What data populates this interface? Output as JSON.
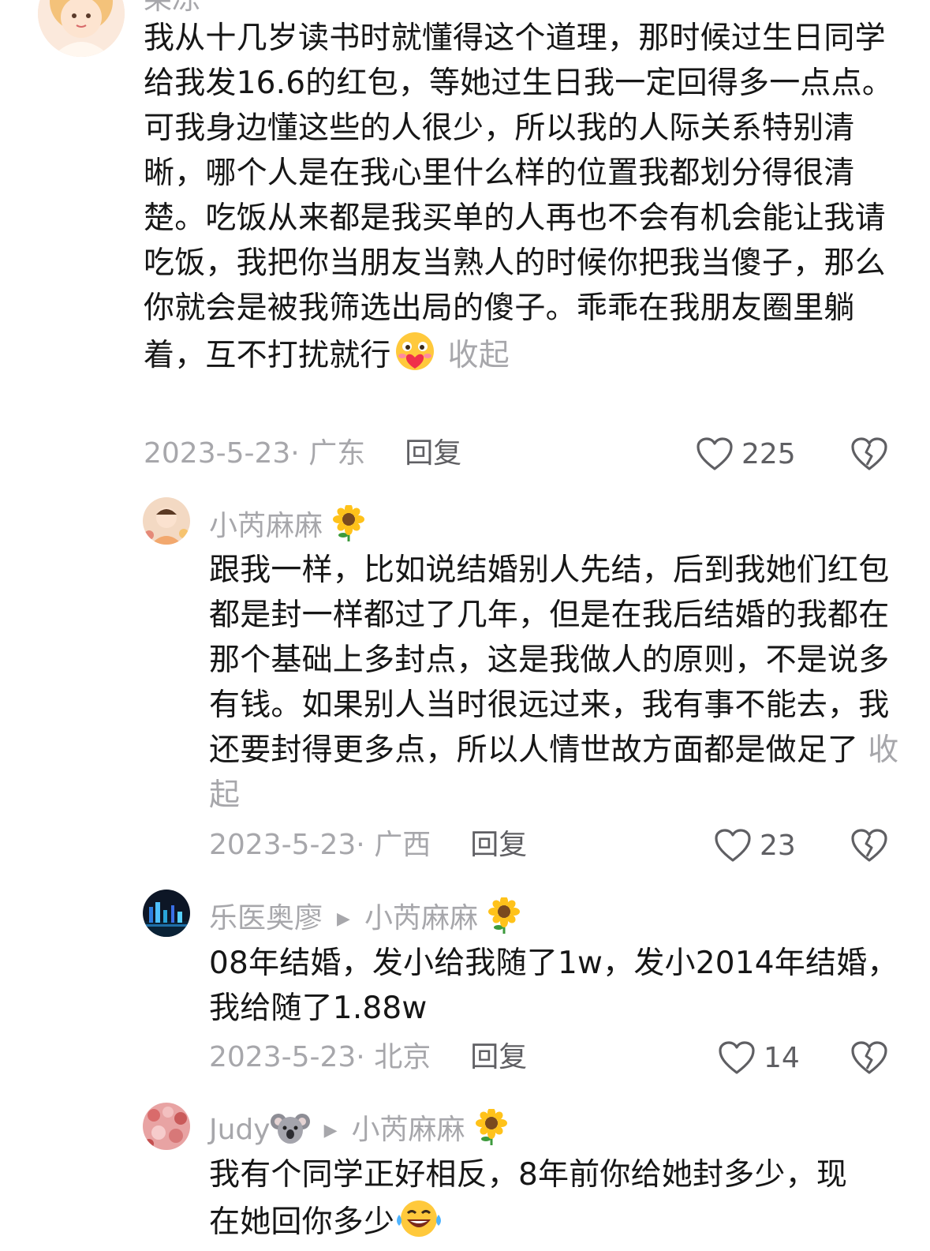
{
  "comments": [
    {
      "username": "果冻",
      "text": "我从十几岁读书时就懂得这个道理，那时候过生日同学给我发16.6的红包，等她过生日我一定回得多一点点。可我身边懂这些的人很少，所以我的人际关系特别清晰，哪个人是在我心里什么样的位置我都划分得很清楚。吃饭从来都是我买单的人再也不会有机会能让我请吃饭，我把你当朋友当熟人的时候你把我当傻子，那么你就会是被我筛选出局的傻子。乖乖在我朋友圈里躺着，互不打扰就行",
      "emoji": "love-face-emoji",
      "fold_label": "收起",
      "date_location": "2023-5-23· 广东",
      "reply_label": "回复",
      "likes": "225"
    },
    {
      "username": "小芮麻麻",
      "username_emoji": "sunflower-emoji",
      "text": "跟我一样，比如说结婚别人先结，后到我她们红包都是封一样都过了几年，但是在我后结婚的我都在那个基础上多封点，这是我做人的原则，不是说多有钱。如果别人当时很远过来，我有事不能去，我还要封得更多点，所以人情世故方面都是做足了",
      "fold_label": "收起",
      "date_location": "2023-5-23· 广西",
      "reply_label": "回复",
      "likes": "23"
    },
    {
      "username": "乐医奥廖",
      "reply_to": "小芮麻麻",
      "reply_to_emoji": "sunflower-emoji",
      "text": "08年结婚，发小给我随了1w，发小2014年结婚，我给随了1.88w",
      "date_location": "2023-5-23· 北京",
      "reply_label": "回复",
      "likes": "14"
    },
    {
      "username": "Judy",
      "username_emoji": "koala-emoji",
      "reply_to": "小芮麻麻",
      "reply_to_emoji": "sunflower-emoji",
      "text": "我有个同学正好相反，8年前你给她封多少，现在她回你多少",
      "emoji": "laughing-tears-emoji"
    }
  ],
  "colors": {
    "text": "#161616",
    "muted": "#a7a7ab",
    "action": "#5f5f63",
    "background": "#ffffff"
  }
}
